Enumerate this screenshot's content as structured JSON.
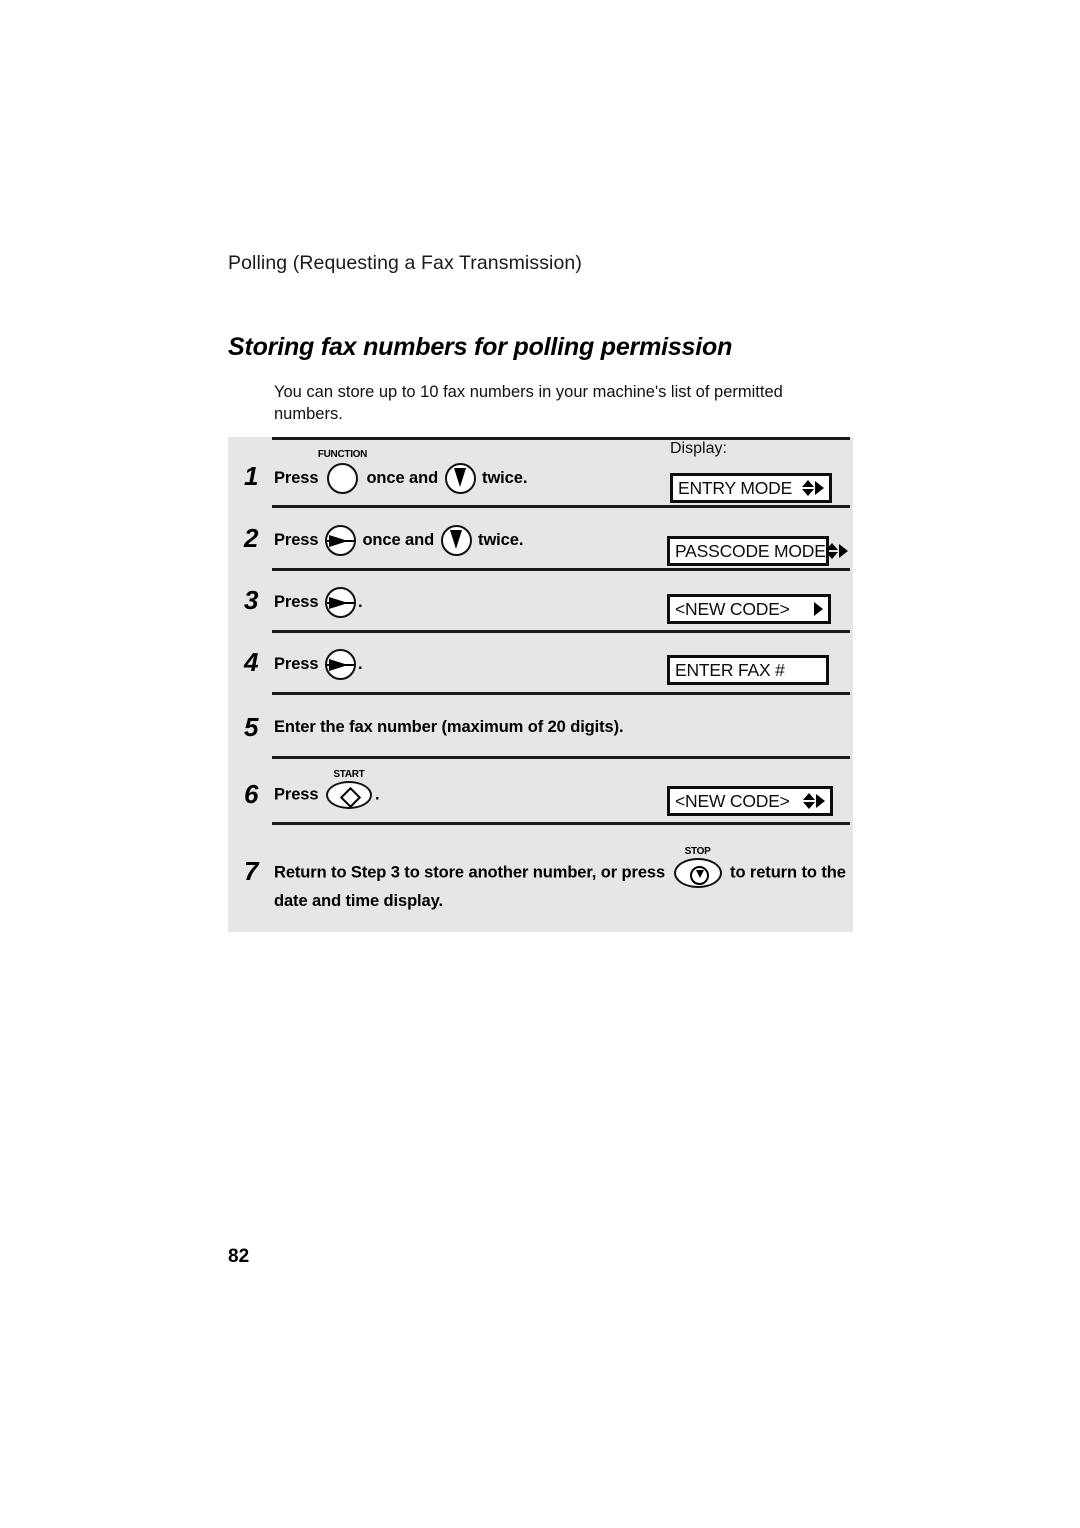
{
  "running_header": "Polling (Requesting a Fax Transmission)",
  "section_title": "Storing fax numbers for polling permission",
  "intro": "You can store up to 10 fax numbers in your machine's list of permitted numbers.",
  "display_column_label": "Display:",
  "page_number": "82",
  "keys": {
    "function_cap": "FUNCTION",
    "start_cap": "START",
    "stop_cap": "STOP"
  },
  "steps": [
    {
      "number": "1",
      "text_before": "Press",
      "text_middle": "once and",
      "text_after": "twice.",
      "display": "ENTRY MODE",
      "display_icons": "updown-right"
    },
    {
      "number": "2",
      "text_before": "Press",
      "text_middle": "once and",
      "text_after": "twice.",
      "display": "PASSCODE MODE",
      "display_icons": "updown-right"
    },
    {
      "number": "3",
      "text_before": "Press",
      "text_after": ".",
      "display": "<NEW CODE>",
      "display_icons": "right"
    },
    {
      "number": "4",
      "text_before": "Press",
      "text_after": ".",
      "display": "ENTER FAX #",
      "display_icons": "none"
    },
    {
      "number": "5",
      "text_full": "Enter the fax number (maximum of 20 digits).",
      "display": "",
      "display_icons": "none"
    },
    {
      "number": "6",
      "text_before": "Press",
      "text_after": ".",
      "display": "<NEW CODE>",
      "display_icons": "updown-right"
    },
    {
      "number": "7",
      "text_before": "Return to Step 3 to store another number, or press",
      "text_after": "to return to the date and time display.",
      "display": "",
      "display_icons": "none"
    }
  ]
}
